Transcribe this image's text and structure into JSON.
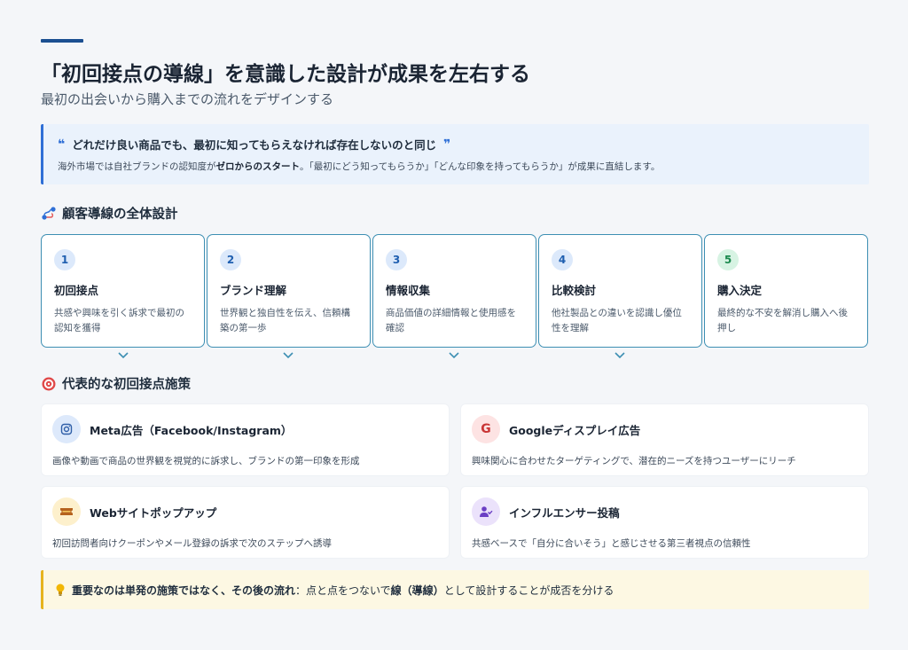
{
  "header": {
    "title": "「初回接点の導線」を意識した設計が成果を左右する",
    "subtitle": "最初の出会いから購入までの流れをデザインする"
  },
  "quote": {
    "open_mark": "❝",
    "text": "どれだけ良い商品でも、最初に知ってもらえなければ存在しないのと同じ",
    "close_mark": "❞",
    "note_prefix": "海外市場では自社ブランドの認知度が",
    "note_bold": "ゼロからのスタート",
    "note_suffix": "。「最初にどう知ってもらうか」「どんな印象を持ってもらうか」が成果に直結します。"
  },
  "journey": {
    "heading": "顧客導線の全体設計",
    "steps": [
      {
        "num": "1",
        "title": "初回接点",
        "desc": "共感や興味を引く訴求で最初の認知を獲得"
      },
      {
        "num": "2",
        "title": "ブランド理解",
        "desc": "世界観と独自性を伝え、信頼構築の第一歩"
      },
      {
        "num": "3",
        "title": "情報収集",
        "desc": "商品価値の詳細情報と使用感を確認"
      },
      {
        "num": "4",
        "title": "比較検討",
        "desc": "他社製品との違いを認識し優位性を理解"
      },
      {
        "num": "5",
        "title": "購入決定",
        "desc": "最終的な不安を解消し購入へ後押し"
      }
    ]
  },
  "tactics": {
    "heading": "代表的な初回接点施策",
    "items": [
      {
        "icon": "instagram-icon",
        "title": "Meta広告（Facebook/Instagram）",
        "desc": "画像や動画で商品の世界観を視覚的に訴求し、ブランドの第一印象を形成"
      },
      {
        "icon": "google-icon",
        "icon_glyph": "G",
        "title": "Googleディスプレイ広告",
        "desc": "興味関心に合わせたターゲティングで、潜在的ニーズを持つユーザーにリーチ"
      },
      {
        "icon": "ticket-icon",
        "title": "Webサイトポップアップ",
        "desc": "初回訪問者向けクーポンやメール登録の訴求で次のステップへ誘導"
      },
      {
        "icon": "user-check-icon",
        "title": "インフルエンサー投稿",
        "desc": "共感ベースで「自分に合いそう」と感じさせる第三者視点の信頼性"
      }
    ]
  },
  "footer": {
    "bold": "重要なのは単発の施策ではなく、その後の流れ",
    "mid": "：点と点をつないで",
    "bold2": "線（導線）",
    "suffix": "として設計することが成否を分ける"
  },
  "colors": {
    "accent": "#1b4f91",
    "quote_bar": "#2f6fd6",
    "step_border": "#3d8fb3",
    "footer_bar": "#e6b31e"
  }
}
